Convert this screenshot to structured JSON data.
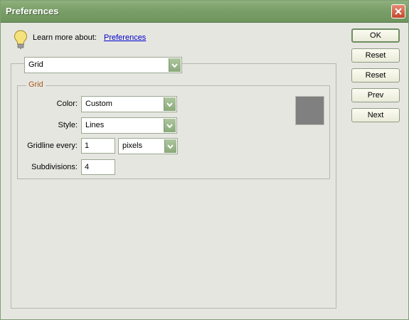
{
  "window": {
    "title": "Preferences"
  },
  "hint": {
    "label": "Learn more about:",
    "link": "Preferences"
  },
  "section": {
    "selected": "Grid"
  },
  "group": {
    "legend": "Grid",
    "color": {
      "label": "Color:",
      "value": "Custom",
      "swatch": "#808080"
    },
    "style": {
      "label": "Style:",
      "value": "Lines"
    },
    "gridline": {
      "label": "Gridline every:",
      "value": "1",
      "unit": "pixels"
    },
    "subdivisions": {
      "label": "Subdivisions:",
      "value": "4"
    }
  },
  "buttons": {
    "ok": "OK",
    "reset1": "Reset",
    "reset2": "Reset",
    "prev": "Prev",
    "next": "Next"
  },
  "colors": {
    "title_bar": "#7a9f68",
    "accent": "#a85a1d",
    "link": "#0000cc"
  }
}
